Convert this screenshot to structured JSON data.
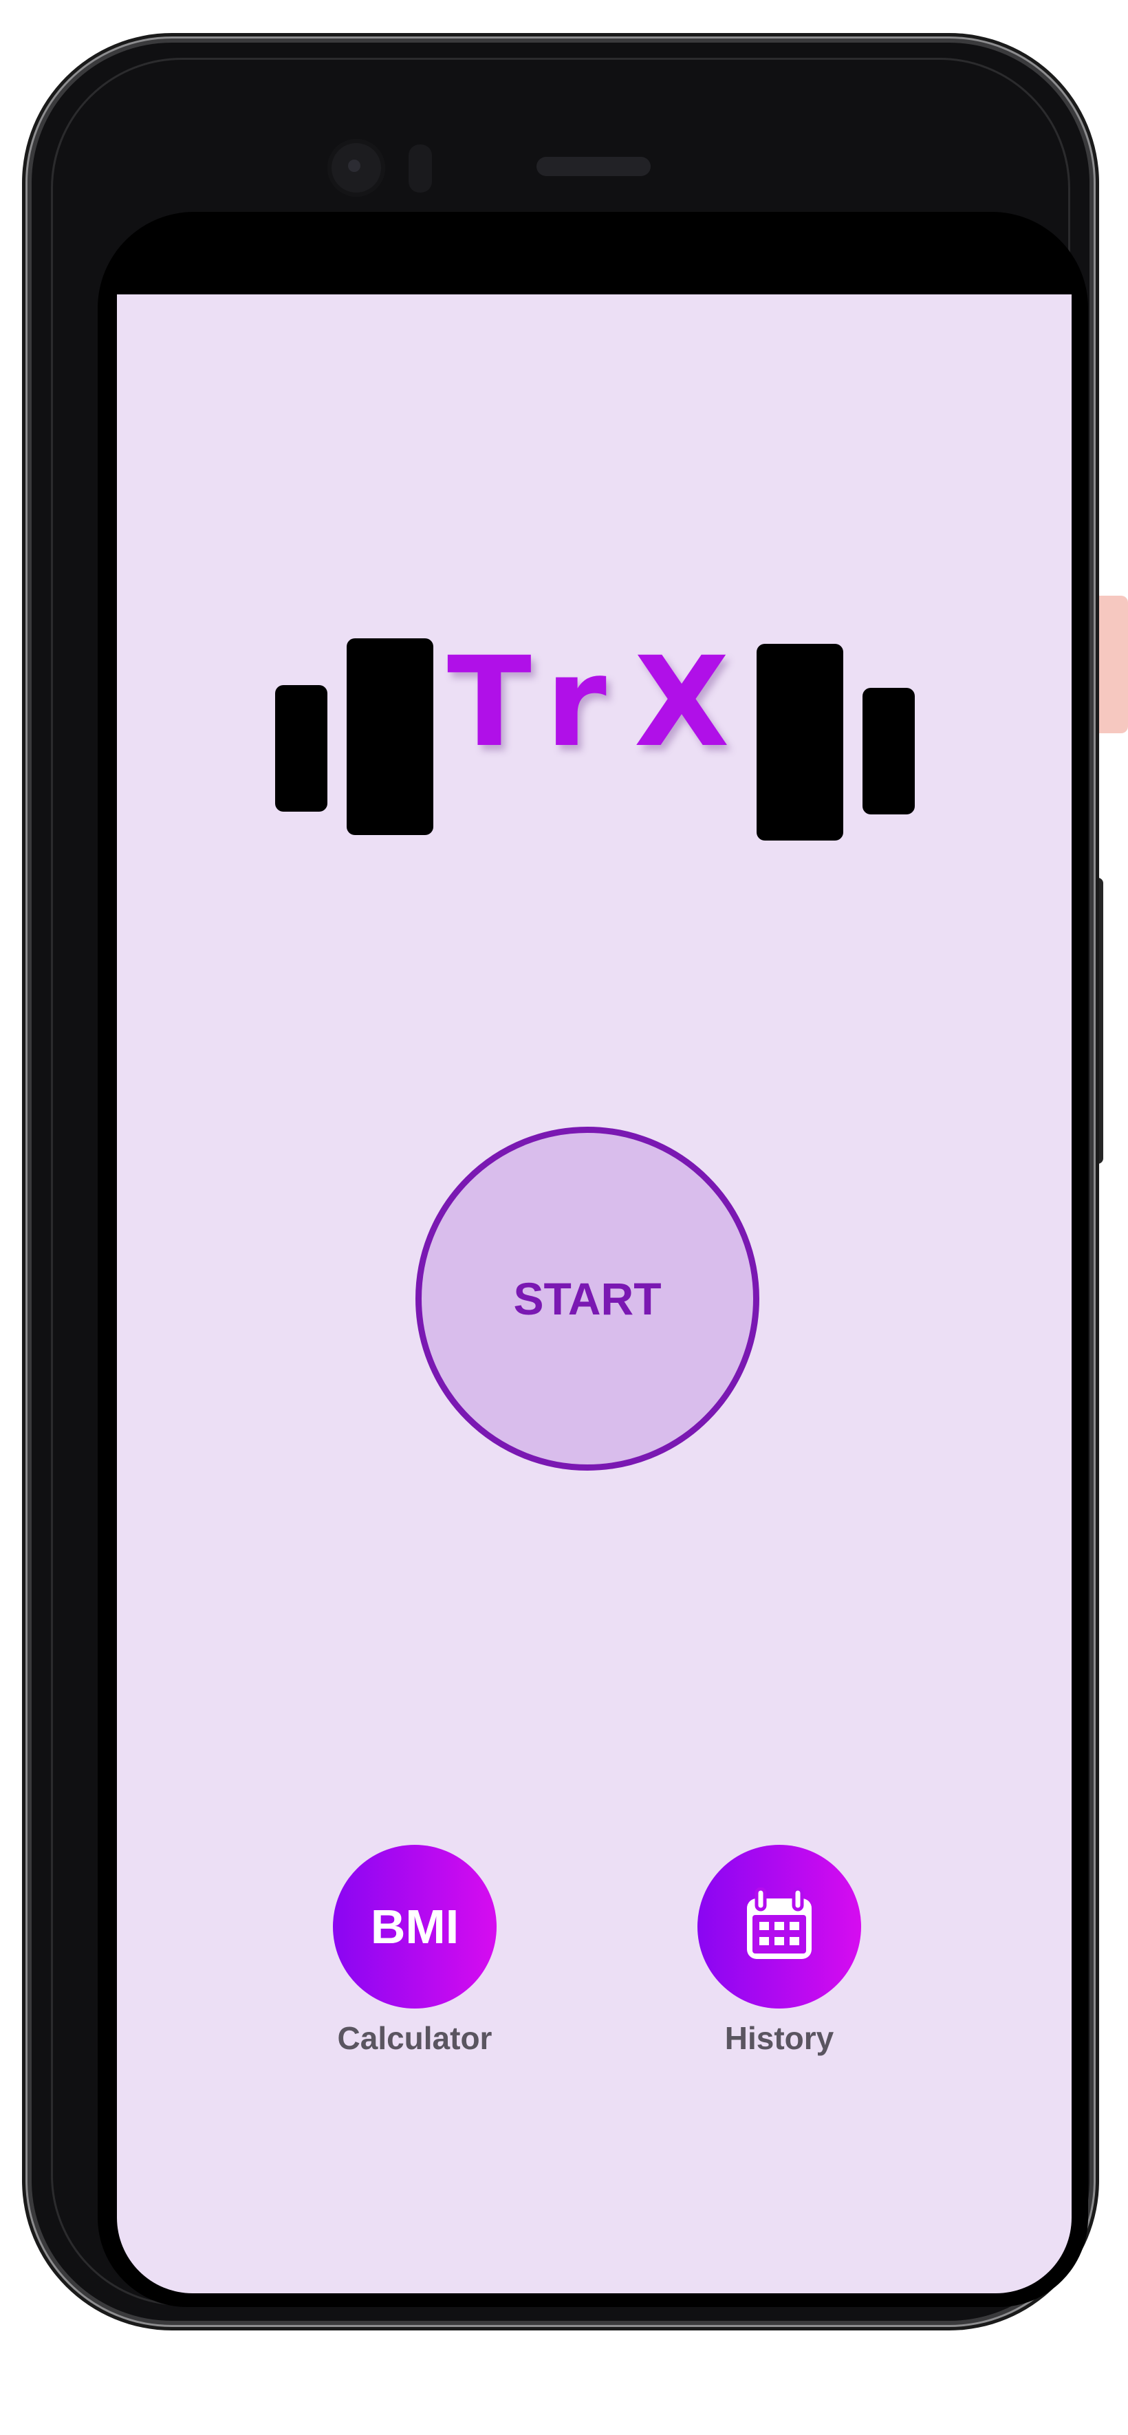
{
  "app": {
    "logo_text": "TrX",
    "accent_color": "#b010e8",
    "background_color": "#ecdff5"
  },
  "start_button": {
    "label": "START"
  },
  "bmi_button": {
    "label": "BMI",
    "caption": "Calculator"
  },
  "history_button": {
    "icon": "calendar-icon",
    "caption": "History"
  }
}
